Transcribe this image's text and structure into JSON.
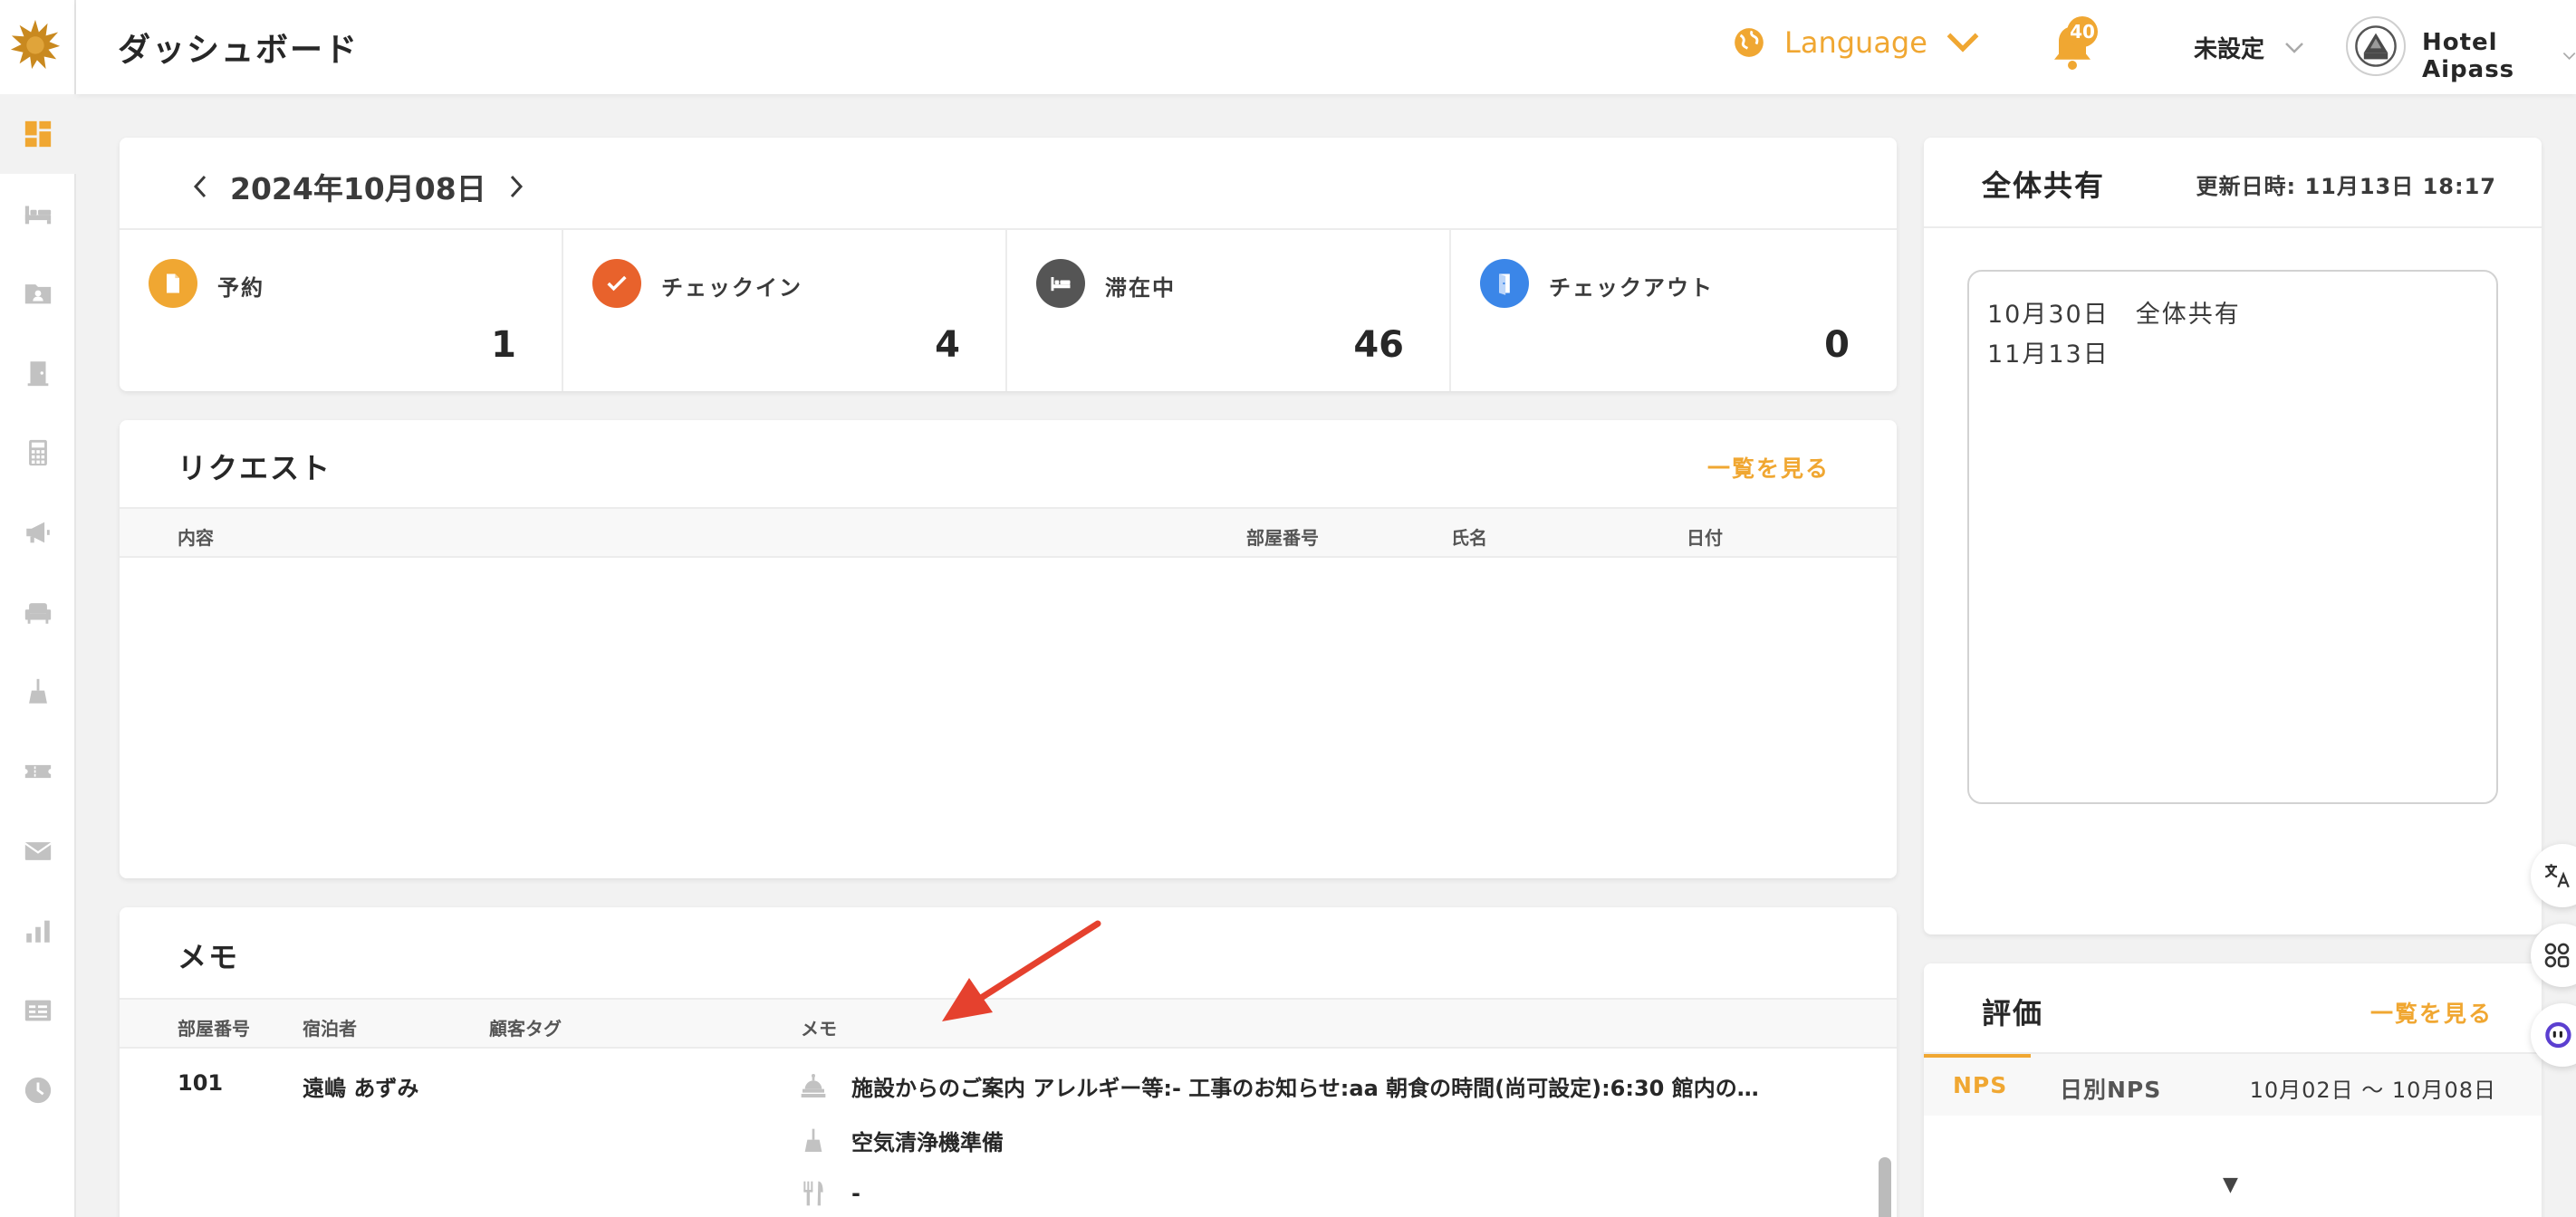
{
  "header": {
    "title": "ダッシュボード",
    "language_label": "Language",
    "notification_count": "40",
    "status_label": "未設定",
    "hotel_name": "Hotel Aipass"
  },
  "colors": {
    "accent": "#f0a732",
    "checkin": "#e8622c",
    "stay": "#555555",
    "checkout": "#3b86e8",
    "annotation": "#e5412e"
  },
  "sidebar": {
    "items": [
      {
        "icon": "dashboard-icon"
      },
      {
        "icon": "bed-icon"
      },
      {
        "icon": "guest-folder-icon"
      },
      {
        "icon": "door-icon"
      },
      {
        "icon": "calculator-icon"
      },
      {
        "icon": "megaphone-icon"
      },
      {
        "icon": "sofa-icon"
      },
      {
        "icon": "cleaning-icon"
      },
      {
        "icon": "ticket-icon"
      },
      {
        "icon": "mail-icon"
      },
      {
        "icon": "bar-chart-icon"
      },
      {
        "icon": "list-icon"
      },
      {
        "icon": "clock-icon"
      }
    ]
  },
  "date_nav": {
    "date": "2024年10月08日"
  },
  "stats": [
    {
      "label": "予約",
      "value": "1",
      "icon": "document-icon"
    },
    {
      "label": "チェックイン",
      "value": "4",
      "icon": "check-icon"
    },
    {
      "label": "滞在中",
      "value": "46",
      "icon": "bed-icon"
    },
    {
      "label": "チェックアウト",
      "value": "0",
      "icon": "exit-door-icon"
    }
  ],
  "requests": {
    "title": "リクエスト",
    "link": "一覧を見る",
    "columns": [
      "内容",
      "部屋番号",
      "氏名",
      "日付"
    ]
  },
  "memo": {
    "title": "メモ",
    "columns": [
      "部屋番号",
      "宿泊者",
      "顧客タグ",
      "メモ"
    ],
    "rows": [
      {
        "room": "101",
        "guest": "遠嶋 あずみ",
        "lines": [
          {
            "icon": "front-desk-icon",
            "text": "施設からのご案内 アレルギー等:- 工事のお知らせ:aa 朝食の時間(尚可設定):6:30 館内の…"
          },
          {
            "icon": "cleaning-icon",
            "text": "空気清浄機準備"
          },
          {
            "icon": "cutlery-icon",
            "text": "-"
          }
        ]
      }
    ]
  },
  "share": {
    "title": "全体共有",
    "updated": "更新日時: 11月13日 18:17",
    "lines": [
      "10月30日　全体共有",
      "11月13日"
    ]
  },
  "evaluation": {
    "title": "評価",
    "link": "一覧を見る",
    "tabs": [
      "NPS",
      "日別NPS"
    ],
    "range": "10月02日 〜 10月08日",
    "caret": "▼"
  }
}
